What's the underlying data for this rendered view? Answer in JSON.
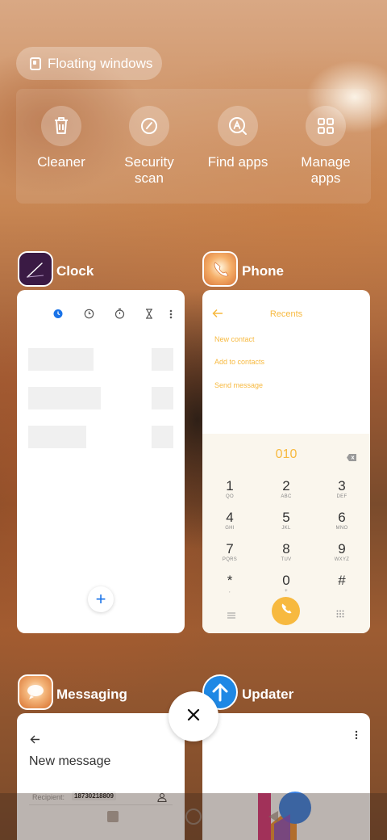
{
  "floating_windows": {
    "label": "Floating windows"
  },
  "quick_tools": [
    {
      "label": "Cleaner",
      "icon": "trash-icon"
    },
    {
      "label": "Security scan",
      "icon": "security-icon"
    },
    {
      "label": "Find apps",
      "icon": "find-apps-icon"
    },
    {
      "label": "Manage apps",
      "icon": "grid-icon"
    }
  ],
  "apps": {
    "clock": {
      "title": "Clock",
      "add_symbol": "+"
    },
    "phone": {
      "title": "Phone",
      "header": "Recents",
      "actions": [
        "New contact",
        "Add to contacts",
        "Send message"
      ],
      "dial_number": "010",
      "keys": [
        {
          "digit": "1",
          "letters": "QO"
        },
        {
          "digit": "2",
          "letters": "ABC"
        },
        {
          "digit": "3",
          "letters": "DEF"
        },
        {
          "digit": "4",
          "letters": "GHI"
        },
        {
          "digit": "5",
          "letters": "JKL"
        },
        {
          "digit": "6",
          "letters": "MNO"
        },
        {
          "digit": "7",
          "letters": "PQRS"
        },
        {
          "digit": "8",
          "letters": "TUV"
        },
        {
          "digit": "9",
          "letters": "WXYZ"
        },
        {
          "digit": "*",
          "letters": ","
        },
        {
          "digit": "0",
          "letters": "+"
        },
        {
          "digit": "#",
          "letters": ""
        }
      ]
    },
    "messaging": {
      "title": "Messaging",
      "header": "New message",
      "recipient_label": "Recipient:",
      "recipient_value": "18730218809"
    },
    "updater": {
      "title": "Updater"
    }
  },
  "colors": {
    "phone_accent": "#f7b93f",
    "clock_accent": "#1a73e8",
    "clock_icon_bg": "#3a1a44"
  }
}
